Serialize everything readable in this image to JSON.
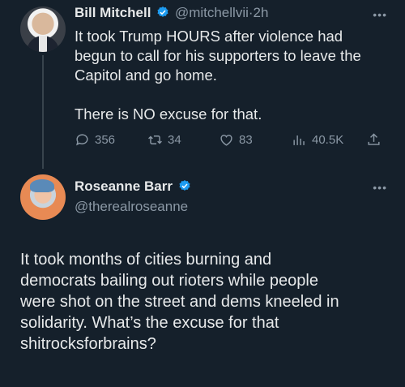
{
  "tweet1": {
    "author_name": "Bill Mitchell",
    "handle": "@mitchellvii",
    "separator": "·",
    "time": "2h",
    "text": "It took Trump HOURS after violence had\nbegun to call for his supporters to leave the\nCapitol and go home.\n\nThere is NO excuse for that.",
    "stats": {
      "replies": "356",
      "retweets": "34",
      "likes": "83",
      "views": "40.5K"
    }
  },
  "tweet2": {
    "author_name": "Roseanne Barr",
    "handle": "@therealroseanne",
    "text": "It took months of cities burning and\ndemocrats bailing out rioters while people\nwere shot on the street and dems kneeled in\nsolidarity. What’s the excuse for that\nshitrocksforbrains?"
  },
  "colors": {
    "background": "#15202b",
    "text": "#e7e9ea",
    "muted": "#8b98a5",
    "verified": "#1d9bf0"
  },
  "icons": [
    "more-icon",
    "verified-icon",
    "reply-icon",
    "retweet-icon",
    "like-icon",
    "views-icon",
    "share-icon"
  ]
}
